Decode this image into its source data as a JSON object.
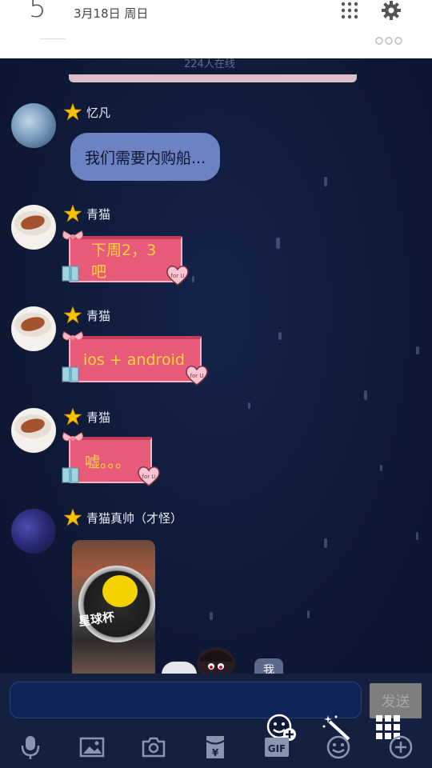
{
  "status": {
    "big_number": "5",
    "date": "3月18日 周日"
  },
  "chat": {
    "online_count": "224人在线",
    "messages": [
      {
        "sender": "忆凡",
        "text": "我们需要内购船..."
      },
      {
        "sender": "青猫",
        "text": "下周2，3吧"
      },
      {
        "sender": "青猫",
        "text": "ios + android"
      },
      {
        "sender": "青猫",
        "text": "嘘。。。"
      },
      {
        "sender": "青猫真帅（才怪）",
        "photo_label": "星球杯"
      }
    ],
    "me_label": "我",
    "gift_tag": "for U"
  },
  "composer": {
    "input_value": "",
    "send_label": "发送"
  },
  "toolbar": {
    "gif_label": "GIF",
    "yen_label": "¥"
  }
}
